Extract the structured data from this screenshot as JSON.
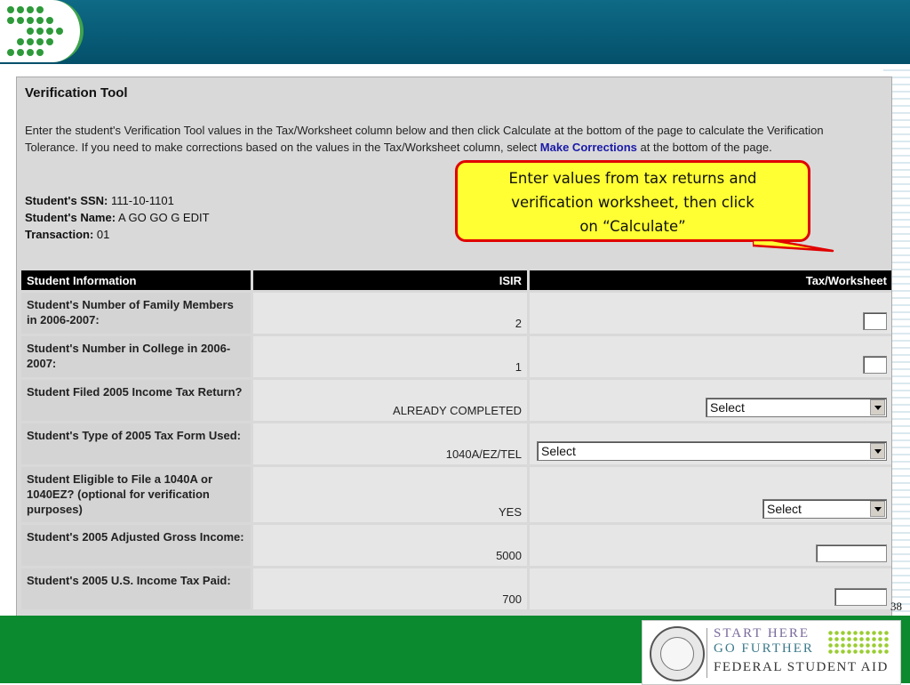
{
  "panel": {
    "title": "Verification Tool",
    "intro_text": "Enter the student's Verification Tool values in the Tax/Worksheet column below and then click Calculate at the bottom of the page to calculate the Verification Tolerance. If you need to make corrections based on the values in the Tax/Worksheet column, select",
    "make_corrections_link": "Make Corrections",
    "intro_tail": "at the bottom of the page."
  },
  "student": {
    "ssn_label": "Student's SSN:",
    "ssn_value": "111-10-1101",
    "name_label": "Student's Name:",
    "name_value": "A GO GO G EDIT",
    "transaction_label": "Transaction:",
    "transaction_value": "01"
  },
  "callout": {
    "line1": "Enter values from tax returns and",
    "line2": "verification worksheet, then click",
    "line3": "on “Calculate”"
  },
  "table": {
    "headers": [
      "Student Information",
      "ISIR",
      "Tax/Worksheet"
    ],
    "rows": [
      {
        "label": "Student's Number of Family Members in 2006-2007:",
        "isir": "2"
      },
      {
        "label": "Student's Number in College in 2006-2007:",
        "isir": "1"
      },
      {
        "label": "Student Filed 2005 Income Tax Return?",
        "isir": "ALREADY COMPLETED",
        "select": "Select"
      },
      {
        "label": "Student's Type of 2005 Tax Form Used:",
        "isir": "1040A/EZ/TEL",
        "select": "Select"
      },
      {
        "label": "Student Eligible to File a 1040A or 1040EZ? (optional for verification purposes)",
        "isir": "YES",
        "select": "Select"
      },
      {
        "label": "Student's 2005 Adjusted Gross Income:",
        "isir": "5000"
      },
      {
        "label": "Student's 2005 U.S. Income Tax Paid:",
        "isir": "700"
      }
    ]
  },
  "footer": {
    "page_number": "38",
    "fsa_line1": "START HERE",
    "fsa_line2": "GO FURTHER",
    "fsa_line3": "FEDERAL STUDENT AID"
  },
  "colors": {
    "top_bar": "#04506a",
    "bottom_band": "#0b8a2f",
    "callout_fill": "#ffff33",
    "callout_border": "#e00000",
    "link": "#1a1aa8"
  }
}
